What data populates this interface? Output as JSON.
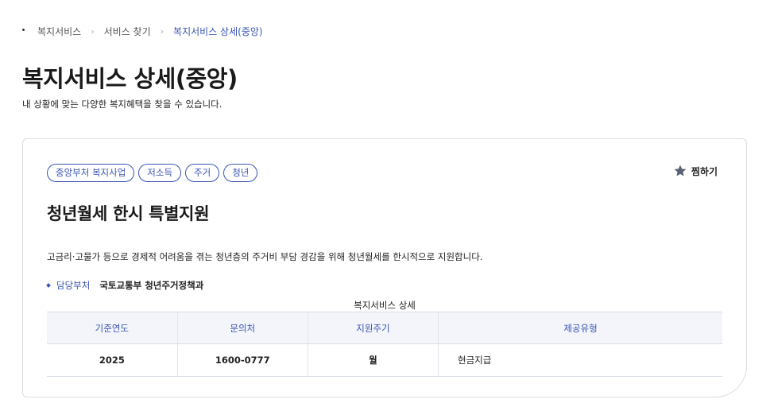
{
  "breadcrumb": {
    "items": [
      "복지서비스",
      "서비스 찾기",
      "복지서비스 상세(중앙)"
    ]
  },
  "page": {
    "title": "복지서비스 상세(중앙)",
    "subtitle": "내 상황에 맞는 다양한 복지혜택을 찾을 수 있습니다."
  },
  "service": {
    "tags": [
      "중앙부처 복지사업",
      "저소득",
      "주거",
      "청년"
    ],
    "bookmark_label": "찜하기",
    "bookmark_icon": "star-icon",
    "title": "청년월세 한시 특별지원",
    "description": "고금리·고물가 등으로 경제적 어려움을 겪는 청년층의 주거비 부담 경감을 위해 청년월세를 한시적으로 지원합니다.",
    "department_label": "담당부처",
    "department_value": "국토교통부 청년주거정책과"
  },
  "table": {
    "caption": "복지서비스 상세",
    "headers": [
      "기준연도",
      "문의처",
      "지원주기",
      "제공유형"
    ],
    "rows": [
      [
        "2025",
        "1600-0777",
        "월",
        "현금지급"
      ]
    ]
  },
  "colors": {
    "accent": "#3a55b5",
    "header_bg": "#f3f5fb",
    "border": "#dddddd"
  }
}
